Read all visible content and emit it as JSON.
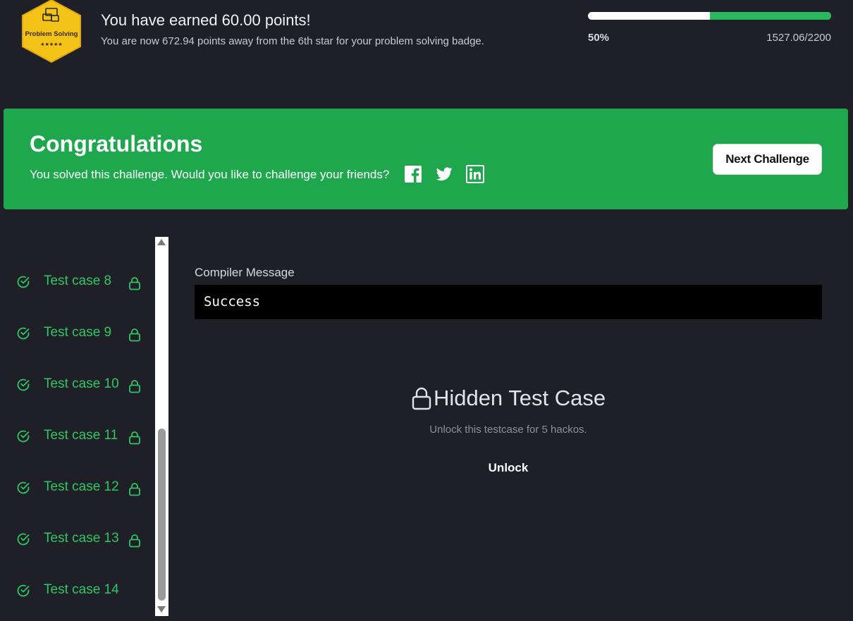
{
  "header": {
    "badge": {
      "label": "Problem Solving",
      "stars": "★★★★★"
    },
    "earned_title": "You have earned 60.00 points!",
    "earned_subtitle": "You are now 672.94 points away from the 6th star for your problem solving badge.",
    "progress": {
      "percent_label": "50%",
      "percent_value": 50,
      "score": "1527.06/2200"
    }
  },
  "banner": {
    "title": "Congratulations",
    "subtitle": "You solved this challenge. Would you like to challenge your friends?",
    "social": [
      "facebook-icon",
      "twitter-icon",
      "linkedin-icon"
    ],
    "next_button": "Next Challenge"
  },
  "test_cases": [
    {
      "label": "Test case 8",
      "locked": true
    },
    {
      "label": "Test case 9",
      "locked": true
    },
    {
      "label": "Test case 10",
      "locked": true
    },
    {
      "label": "Test case 11",
      "locked": true
    },
    {
      "label": "Test case 12",
      "locked": true
    },
    {
      "label": "Test case 13",
      "locked": true
    },
    {
      "label": "Test case 14",
      "locked": false
    }
  ],
  "main": {
    "compiler_label": "Compiler Message",
    "compiler_output": "Success",
    "hidden_title": "Hidden Test Case",
    "unlock_description": "Unlock this testcase for 5 hackos.",
    "unlock_button": "Unlock"
  },
  "colors": {
    "background": "#1f1f28",
    "accent_green": "#1ea74d",
    "test_case_green": "#2ec764",
    "badge_gold": "#f5c518"
  }
}
